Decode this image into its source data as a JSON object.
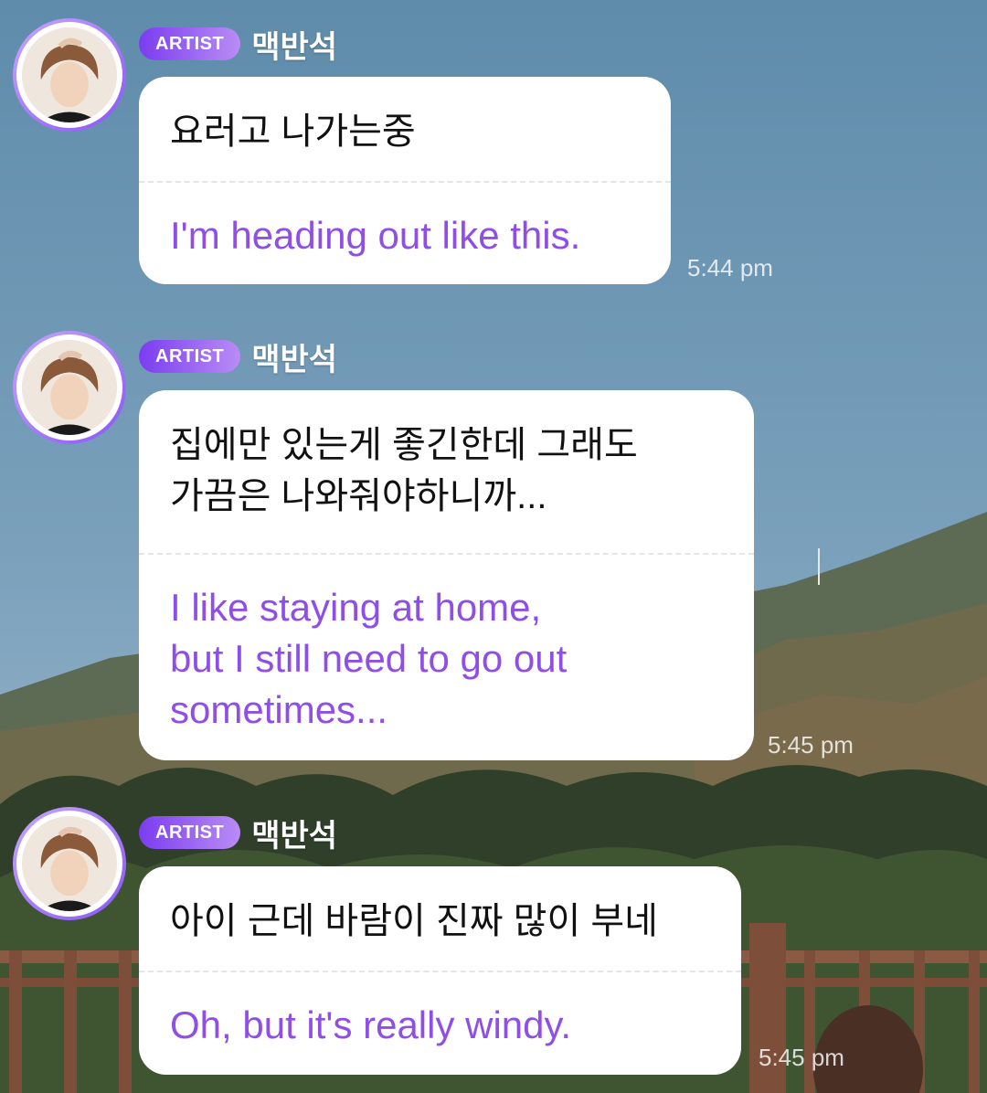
{
  "messages": [
    {
      "badge": "ARTIST",
      "name": "맥반석",
      "original": "요러고 나가는중",
      "translation": "I'm heading out like this.",
      "time": "5:44 pm"
    },
    {
      "badge": "ARTIST",
      "name": "맥반석",
      "original": "집에만 있는게 좋긴한데 그래도\n가끔은 나와줘야하니까...",
      "translation": "I like staying at home,\nbut I still need to go out\nsometimes...",
      "time": "5:45 pm"
    },
    {
      "badge": "ARTIST",
      "name": "맥반석",
      "original": "아이 근데 바람이 진짜 많이 부네",
      "translation": "Oh, but it's really windy.",
      "time": "5:45 pm"
    }
  ],
  "colors": {
    "badge_start": "#7b3df0",
    "badge_end": "#b98cf5",
    "translation_text": "#8f4ee6",
    "sky": "#6f97b3"
  },
  "icons": {
    "avatar": "profile-photo"
  }
}
